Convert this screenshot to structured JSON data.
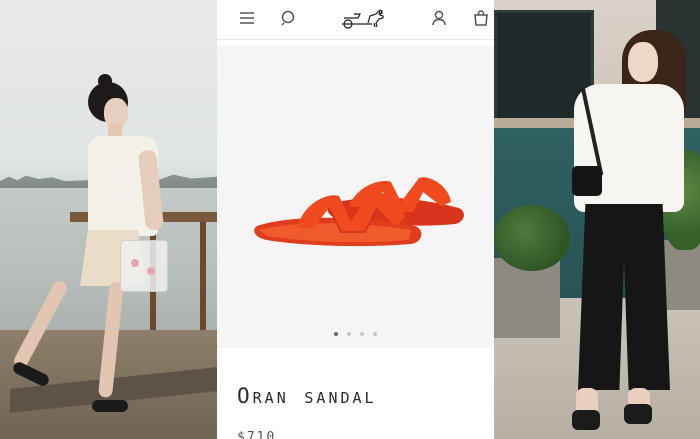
{
  "header": {
    "menu_icon": "hamburger-menu-icon",
    "search_icon": "search-icon",
    "logo_icon": "horse-carriage-logo",
    "account_icon": "user-account-icon",
    "cart_icon": "shopping-bag-icon"
  },
  "gallery": {
    "image_subject": "orange-sandal",
    "slide_count": 4,
    "active_slide": 1
  },
  "product": {
    "name": "Oran sandal",
    "price": "$710"
  },
  "colors": {
    "sandal_orange": "#f04a1e",
    "background_grey": "#f5f5f5",
    "text_dark": "#2b2b2b"
  }
}
